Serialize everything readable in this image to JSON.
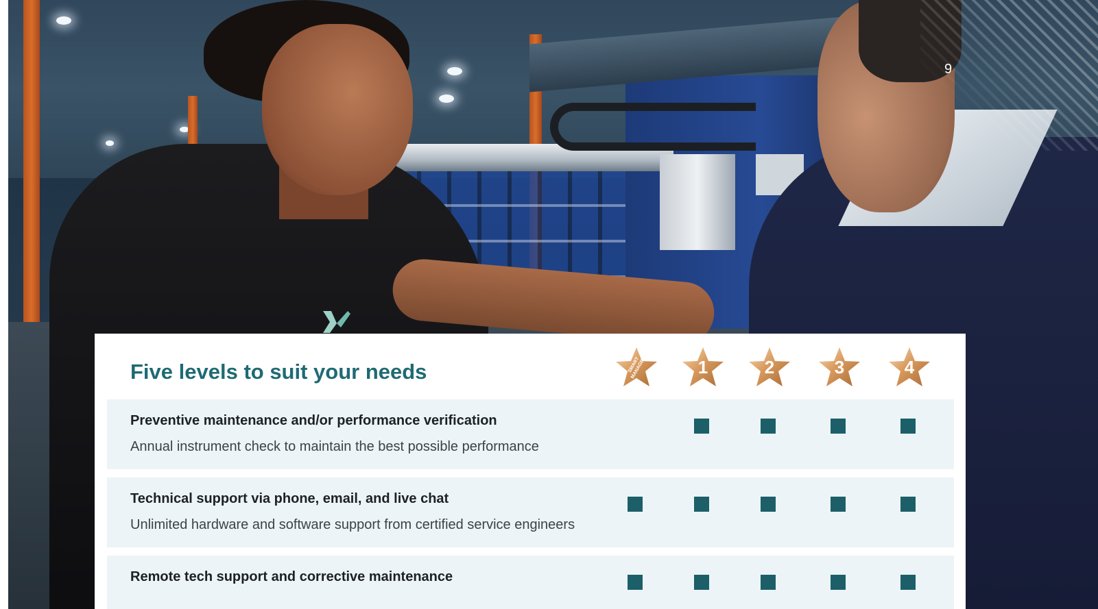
{
  "page_number": "9",
  "photo": {
    "description_icon": "photo-icon"
  },
  "panel": {
    "title": "Five levels to suit your needs",
    "accent_color": "#1f6a73",
    "check_color": "#1c5f68",
    "row_background": "#ecf4f7",
    "levels": [
      {
        "label": "SMART\nMANAGER",
        "icon": "star-icon"
      },
      {
        "label": "1",
        "icon": "star-icon"
      },
      {
        "label": "2",
        "icon": "star-icon"
      },
      {
        "label": "3",
        "icon": "star-icon"
      },
      {
        "label": "4",
        "icon": "star-icon"
      }
    ],
    "rows": [
      {
        "title": "Preventive maintenance and/or performance verification",
        "description": "Annual instrument check to maintain the best possible performance",
        "included": [
          false,
          true,
          true,
          true,
          true
        ]
      },
      {
        "title": "Technical support via phone, email, and live chat",
        "description": "Unlimited hardware and software support from certified service engineers",
        "included": [
          true,
          true,
          true,
          true,
          true
        ]
      },
      {
        "title": "Remote tech support and corrective maintenance",
        "description": "",
        "included": [
          true,
          true,
          true,
          true,
          true
        ]
      }
    ]
  }
}
